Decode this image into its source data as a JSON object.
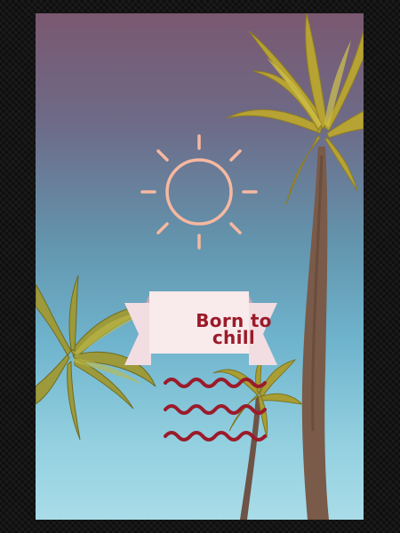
{
  "poster": {
    "title_line1": "Born to",
    "title_line2": "chill",
    "icons": [
      "sun-icon",
      "waves-icon",
      "palm-tree-image"
    ],
    "colors": {
      "sun": "#f7b8a0",
      "banner": "#f9eaec",
      "accent_red": "#9b1b2a",
      "sky_top": "#7a5870",
      "sky_bottom": "#a9dce8"
    }
  }
}
